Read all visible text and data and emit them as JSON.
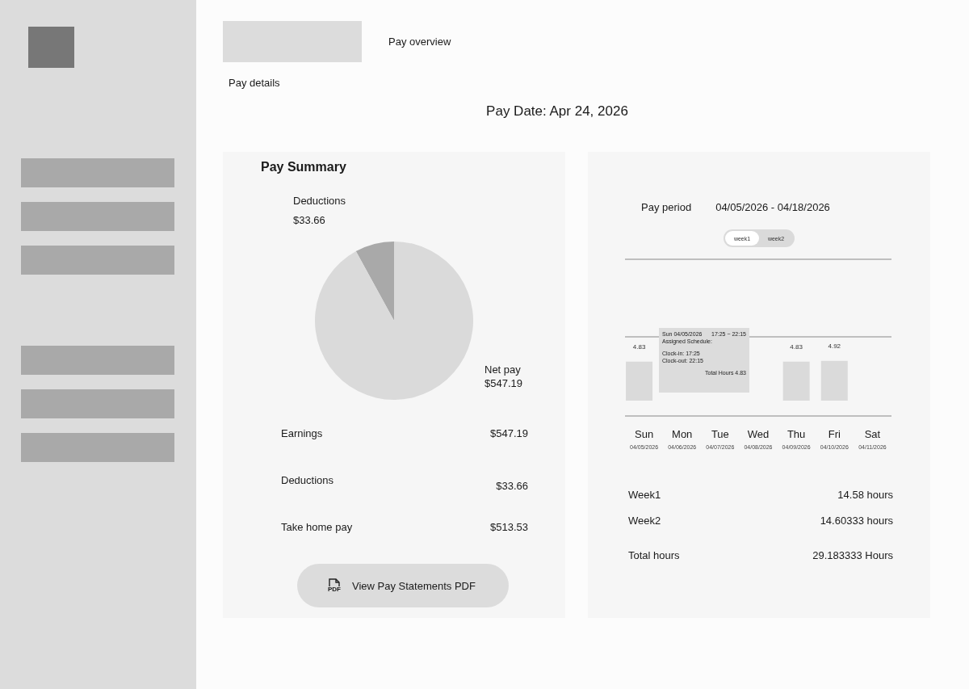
{
  "sidebar": {
    "nav_items": [
      {
        "kind": "item"
      },
      {
        "kind": "item"
      },
      {
        "kind": "item"
      },
      {
        "kind": "gap"
      },
      {
        "kind": "item"
      },
      {
        "kind": "item"
      },
      {
        "kind": "item"
      }
    ]
  },
  "header": {
    "tabs": [
      "Pay overview",
      "Pay details"
    ],
    "pay_date": "Pay Date: Apr 24, 2026"
  },
  "pay_summary": {
    "title": "Pay Summary",
    "chart_data": {
      "type": "pie",
      "values": [
        8,
        92
      ],
      "colors": [
        "#a9a9a9",
        "#dadada"
      ]
    },
    "legend": [
      {
        "label": "Deductions",
        "amount": "$33.66"
      },
      {
        "label": "Net pay",
        "amount": "$547.19"
      }
    ],
    "rows": [
      {
        "label": "Earnings",
        "value": "$547.19"
      },
      {
        "label": "Deductions",
        "value": "$33.66"
      },
      {
        "label": "Take home pay",
        "value": "$513.53"
      }
    ],
    "button": "View Pay Statements PDF",
    "button_icon_text": "PDF"
  },
  "pay_period": {
    "label": "Pay period",
    "range": "04/05/2026 - 04/18/2026",
    "toggle": [
      {
        "label": "week1",
        "selected": true
      },
      {
        "label": "week2",
        "selected": false
      }
    ],
    "chart_data": {
      "type": "bar",
      "categories": [
        "Sun",
        "Mon",
        "Tue",
        "Wed",
        "Thu",
        "Fri",
        "Sat"
      ],
      "values": [
        4.83,
        null,
        null,
        null,
        4.83,
        4.92,
        null
      ],
      "data_labels": true
    },
    "dates": [
      "04/05/2026",
      "04/06/2026",
      "04/07/2026",
      "04/08/2026",
      "04/09/2026",
      "04/10/2026",
      "04/11/2026"
    ],
    "tooltip": {
      "date": "Sun 04/05/2026",
      "time": "17:25 ~ 22:15",
      "schedule": "Assigned Schedule:",
      "clock_in": "Clock-in: 17:25",
      "clock_out": "Clock-out: 22:15",
      "total": "Total Hours 4.83"
    },
    "totals": [
      {
        "label": "Week1",
        "value": "14.58 hours"
      },
      {
        "label": "Week2",
        "value": "14.60333 hours"
      },
      {
        "label": "Total hours",
        "value": "29.183333 Hours"
      }
    ]
  }
}
